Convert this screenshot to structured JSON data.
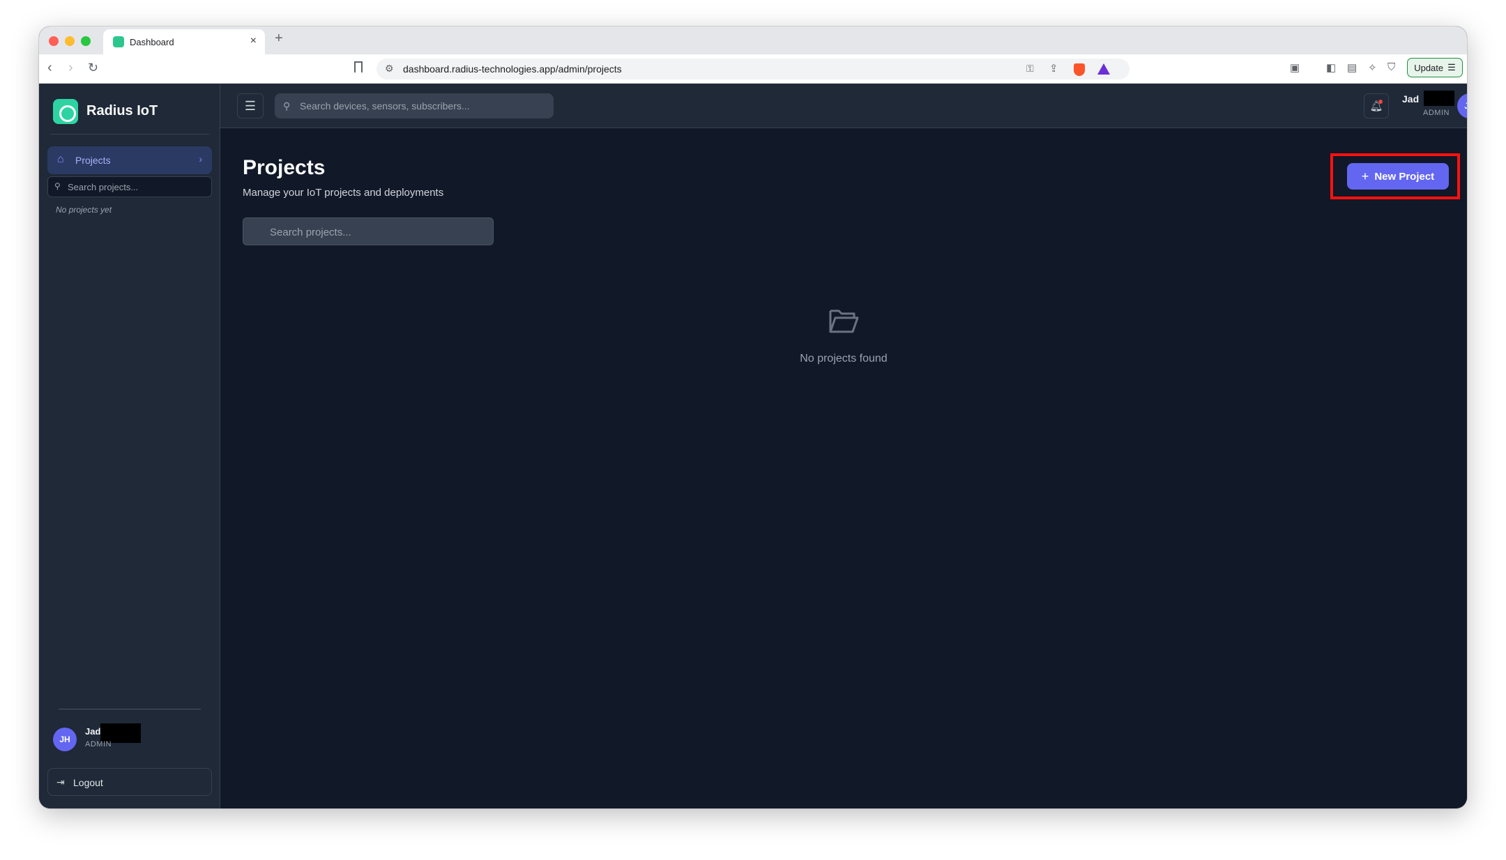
{
  "browser": {
    "tab_title": "Dashboard",
    "tab_close": "×",
    "new_tab": "+",
    "url": "dashboard.radius-technologies.app/admin/projects",
    "update_label": "Update"
  },
  "sidebar": {
    "brand": "Radius IoT",
    "nav": [
      {
        "label": "Projects",
        "icon": "home-icon"
      }
    ],
    "search_placeholder": "Search projects...",
    "empty_text": "No projects yet",
    "user": {
      "name": "Jad",
      "role": "ADMIN",
      "initials": "JH"
    },
    "logout_label": "Logout"
  },
  "header": {
    "search_placeholder": "Search devices, sensors, subscribers...",
    "user": {
      "name": "Jad",
      "role": "ADMIN",
      "initials": "JH"
    }
  },
  "main": {
    "title": "Projects",
    "subtitle": "Manage your IoT projects and deployments",
    "new_project_label": "New Project",
    "search_placeholder": "Search projects...",
    "empty_text": "No projects found"
  },
  "colors": {
    "accent": "#6366f1",
    "brand": "#2dd4a2",
    "background": "#111827",
    "surface": "#1f2937",
    "highlight": "#ff1111"
  }
}
